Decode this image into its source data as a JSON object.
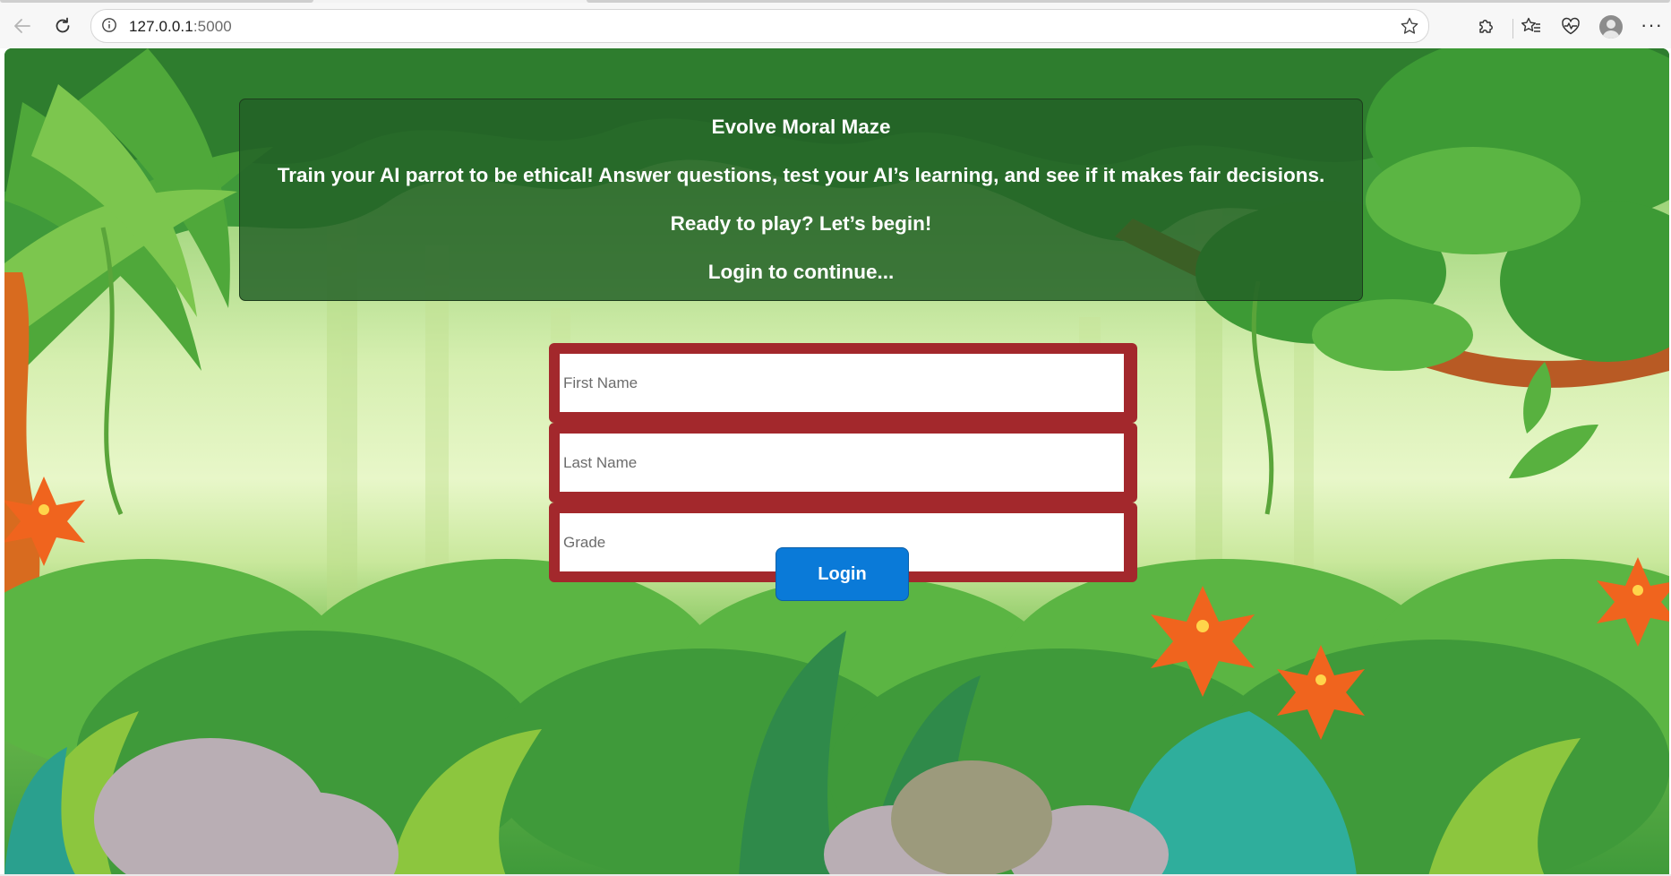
{
  "browser": {
    "url_host": "127.0.0.1",
    "url_port": ":5000",
    "icons": [
      "back-icon",
      "refresh-icon",
      "site-info-icon",
      "favorite-star-icon",
      "extensions-icon",
      "favorites-icon",
      "browser-essentials-icon",
      "profile-avatar-icon",
      "more-icon"
    ],
    "more_label": "···"
  },
  "welcome": {
    "title": "Evolve Moral Maze",
    "intro": "Train your AI parrot to be ethical! Answer questions, test your AI’s learning, and see if it makes fair decisions.",
    "ready": "Ready to play? Let’s begin!",
    "prompt": "Login to continue..."
  },
  "form": {
    "first_name_placeholder": "First Name",
    "last_name_placeholder": "Last Name",
    "grade_placeholder": "Grade",
    "first_name_value": "",
    "last_name_value": "",
    "grade_value": "",
    "login_label": "Login"
  },
  "colors": {
    "panel_bg": "#226026",
    "field_border": "#a3282c",
    "button_bg": "#0a7ad8"
  }
}
